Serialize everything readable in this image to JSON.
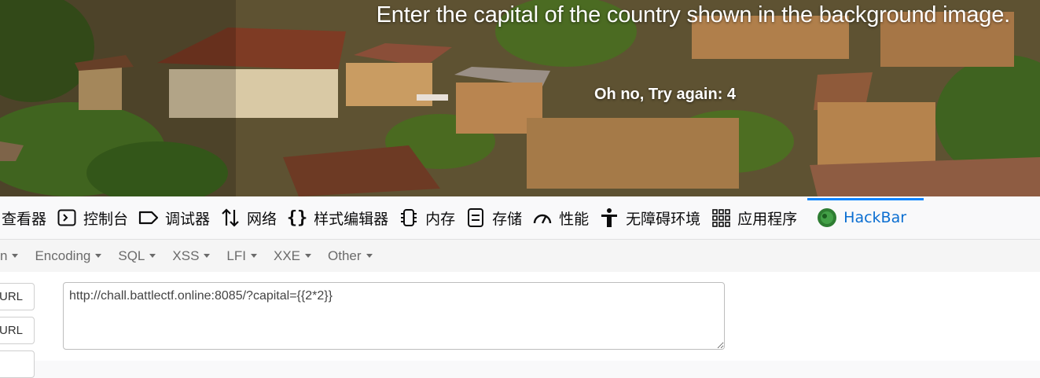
{
  "page": {
    "heading": "Enter the capital of the country shown in the background image.",
    "result": "Oh no, Try again: 4"
  },
  "devtools": {
    "tabs": [
      {
        "label": "查看器",
        "icon": "inspector-icon"
      },
      {
        "label": "控制台",
        "icon": "console-icon"
      },
      {
        "label": "调试器",
        "icon": "debugger-icon"
      },
      {
        "label": "网络",
        "icon": "network-icon"
      },
      {
        "label": "样式编辑器",
        "icon": "style-editor-icon"
      },
      {
        "label": "内存",
        "icon": "memory-icon"
      },
      {
        "label": "存储",
        "icon": "storage-icon"
      },
      {
        "label": "性能",
        "icon": "performance-icon"
      },
      {
        "label": "无障碍环境",
        "icon": "accessibility-icon"
      },
      {
        "label": "应用程序",
        "icon": "application-icon"
      },
      {
        "label": "HackBar",
        "icon": "hackbar-icon",
        "active": true
      }
    ],
    "active_color": "#0a84ff"
  },
  "hackbar": {
    "menu": [
      "n",
      "Encoding",
      "SQL",
      "XSS",
      "LFI",
      "XXE",
      "Other"
    ],
    "buttons": [
      "URL",
      "URL"
    ],
    "url_value": "http://chall.battlectf.online:8085/?capital={{2*2}}"
  }
}
